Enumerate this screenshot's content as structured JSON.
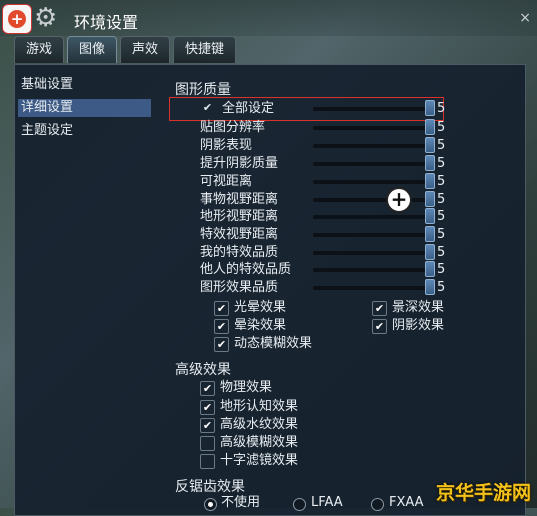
{
  "window": {
    "title": "环境设置",
    "close_glyph": "×"
  },
  "tabs": [
    {
      "label": "游戏",
      "active": false
    },
    {
      "label": "图像",
      "active": true
    },
    {
      "label": "声效",
      "active": false
    },
    {
      "label": "快捷键",
      "active": false
    }
  ],
  "sidebar": {
    "items": [
      {
        "label": "基础设置",
        "selected": false
      },
      {
        "label": "详细设置",
        "selected": true
      },
      {
        "label": "主题设定",
        "selected": false
      }
    ]
  },
  "graphics": {
    "title": "图形质量",
    "sliders": [
      {
        "label": "全部设定",
        "value": "5",
        "checked": true
      },
      {
        "label": "贴图分辨率",
        "value": "5"
      },
      {
        "label": "阴影表现",
        "value": "5"
      },
      {
        "label": "提升阴影质量",
        "value": "5"
      },
      {
        "label": "可视距离",
        "value": "5"
      },
      {
        "label": "事物视野距离",
        "value": "5"
      },
      {
        "label": "地形视野距离",
        "value": "5"
      },
      {
        "label": "特效视野距离",
        "value": "5"
      },
      {
        "label": "我的特效品质",
        "value": "5"
      },
      {
        "label": "他人的特效品质",
        "value": "5"
      },
      {
        "label": "图形效果品质",
        "value": "5"
      }
    ],
    "effects": [
      {
        "label": "光晕效果",
        "checked": true
      },
      {
        "label": "景深效果",
        "checked": true
      },
      {
        "label": "晕染效果",
        "checked": true
      },
      {
        "label": "阴影效果",
        "checked": true
      },
      {
        "label": "动态模糊效果",
        "checked": true
      }
    ]
  },
  "advanced": {
    "title": "高级效果",
    "options": [
      {
        "label": "物理效果",
        "checked": true
      },
      {
        "label": "地形认知效果",
        "checked": true
      },
      {
        "label": "高级水纹效果",
        "checked": true
      },
      {
        "label": "高级模糊效果",
        "checked": false
      },
      {
        "label": "十字滤镜效果",
        "checked": false
      }
    ]
  },
  "antialias": {
    "title": "反锯齿效果",
    "options": [
      {
        "label": "不使用",
        "selected": true
      },
      {
        "label": "LFAA",
        "selected": false
      },
      {
        "label": "FXAA",
        "selected": false
      }
    ]
  },
  "watermark": "京华手游网",
  "colors": {
    "highlight_box": "#d9322b",
    "selected_item": "#3c5a85",
    "watermark": "#f3c21a"
  }
}
